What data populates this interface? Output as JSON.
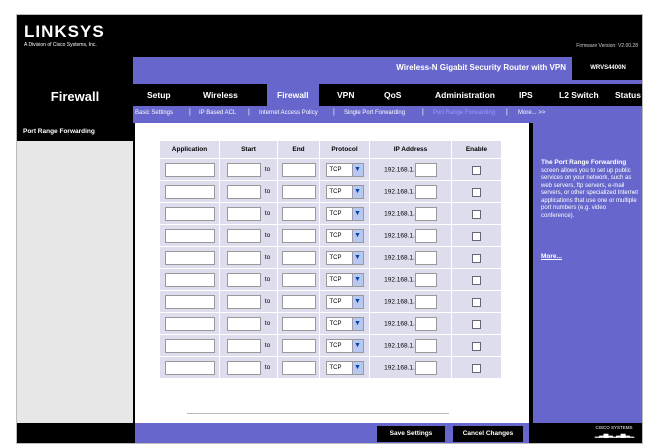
{
  "header": {
    "brand": "LINKSYS",
    "brand_sub": "A Division of Cisco Systems, Inc.",
    "firmware": "Firmware Version: V2.00.28",
    "product_name": "Wireless-N Gigabit Security Router with VPN",
    "model": "WRVS4400N"
  },
  "section_title": "Firewall",
  "tabs": [
    {
      "label": "Setup"
    },
    {
      "label": "Wireless"
    },
    {
      "label": "Firewall"
    },
    {
      "label": "VPN"
    },
    {
      "label": "QoS"
    },
    {
      "label": "Administration"
    },
    {
      "label": "IPS"
    },
    {
      "label": "L2 Switch"
    },
    {
      "label": "Status"
    }
  ],
  "subtabs": [
    {
      "label": "Basic Settings"
    },
    {
      "label": "IP Based ACL"
    },
    {
      "label": "Internet Access Policy"
    },
    {
      "label": "Single Port Forwarding"
    },
    {
      "label": "Port Range Forwarding"
    },
    {
      "label": "More... >>"
    }
  ],
  "side_heading": "Port Range Forwarding",
  "table": {
    "headers": [
      "Application",
      "Start",
      "End",
      "Protocol",
      "IP Address",
      "Enable"
    ],
    "to_label": "to",
    "protocol_value": "TCP",
    "ip_prefix": "192.168.1.",
    "row_count": 10
  },
  "help": {
    "title": "The Port Range Forwarding",
    "body": "screen allows you to set up public services on your network, such as web servers, ftp servers, e-mail servers, or other specialized Internet applications that use one or multiple port numbers (e.g. video conference).",
    "more": "More..."
  },
  "footer": {
    "save": "Save Settings",
    "cancel": "Cancel Changes",
    "cisco": "CISCO SYSTEMS"
  },
  "colors": {
    "accent": "#6666cc",
    "table_cell": "#dde",
    "header_bg": "#000000"
  }
}
